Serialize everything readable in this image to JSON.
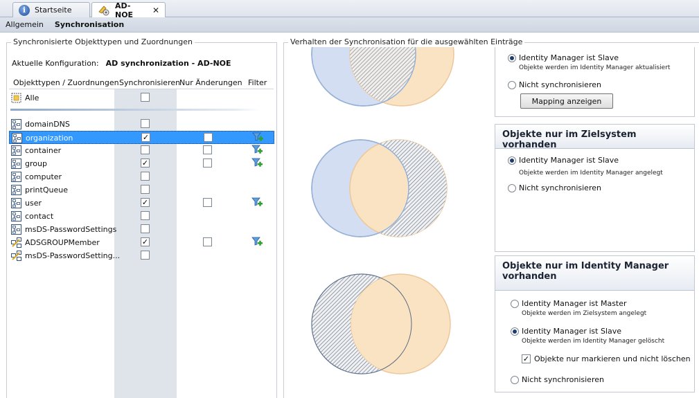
{
  "tabs": [
    {
      "label": "Startseite",
      "icon": "info-icon"
    },
    {
      "label": "AD-NOE",
      "icon": "sync-icon",
      "close": "✕"
    }
  ],
  "subtabs": [
    "Allgemein",
    "Synchronisation"
  ],
  "left": {
    "legend": "Synchronisierte Objekttypen und Zuordnungen",
    "config_label": "Aktuelle Konfiguration:",
    "config_value": "AD synchronization - AD-NOE",
    "columns": [
      "Objekttypen / Zuordnungen",
      "Synchronisieren",
      "Nur Änderungen",
      "Filter"
    ],
    "all_label": "Alle",
    "rows": [
      {
        "label": "domainDNS",
        "sync": false,
        "changes": null,
        "filter": false,
        "selected": false,
        "icon": "object-type-icon"
      },
      {
        "label": "organization",
        "sync": true,
        "changes": false,
        "filter": true,
        "selected": true,
        "icon": "object-type-icon"
      },
      {
        "label": "container",
        "sync": false,
        "changes": false,
        "filter": true,
        "selected": false,
        "icon": "object-type-icon"
      },
      {
        "label": "group",
        "sync": true,
        "changes": false,
        "filter": true,
        "selected": false,
        "icon": "object-type-icon"
      },
      {
        "label": "computer",
        "sync": false,
        "changes": null,
        "filter": false,
        "selected": false,
        "icon": "object-type-icon"
      },
      {
        "label": "printQueue",
        "sync": false,
        "changes": null,
        "filter": false,
        "selected": false,
        "icon": "object-type-icon"
      },
      {
        "label": "user",
        "sync": true,
        "changes": false,
        "filter": true,
        "selected": false,
        "icon": "object-type-icon"
      },
      {
        "label": "contact",
        "sync": false,
        "changes": null,
        "filter": false,
        "selected": false,
        "icon": "object-type-icon"
      },
      {
        "label": "msDS-PasswordSettings",
        "sync": false,
        "changes": null,
        "filter": false,
        "selected": false,
        "icon": "object-type-icon"
      },
      {
        "label": "ADSGROUPMember",
        "sync": true,
        "changes": false,
        "filter": true,
        "selected": false,
        "icon": "mapping-icon"
      },
      {
        "label": "msDS-PasswordSetting...",
        "sync": false,
        "changes": null,
        "filter": false,
        "selected": false,
        "icon": "mapping-icon"
      }
    ]
  },
  "right": {
    "legend": "Verhalten der Synchronisation für die ausgewählten Einträge",
    "section1": {
      "opt1": "Identity Manager ist Slave",
      "opt1_sub": "Objekte werden im Identity Manager aktualisiert",
      "opt2": "Nicht synchronisieren",
      "button": "Mapping anzeigen"
    },
    "section2": {
      "title": "Objekte nur im Zielsystem vorhanden",
      "opt1": "Identity Manager ist Slave",
      "opt1_sub": "Objekte werden im Identity Manager angelegt",
      "opt2": "Nicht synchronisieren"
    },
    "section3": {
      "title": "Objekte nur im Identity Manager vorhanden",
      "opt1": "Identity Manager ist Master",
      "opt1_sub": "Objekte werden im Zielsystem angelegt",
      "opt2": "Identity Manager ist Slave",
      "opt2_sub": "Objekte werden im Identity Manager gelöscht",
      "checkbox": "Objekte nur markieren und nicht löschen",
      "opt3": "Nicht synchronisieren"
    }
  },
  "colors": {
    "selection": "#3399ff",
    "venn_blue": "#c8d8f0",
    "venn_orange": "#f8deb8",
    "filter_green": "#2ea02e"
  }
}
